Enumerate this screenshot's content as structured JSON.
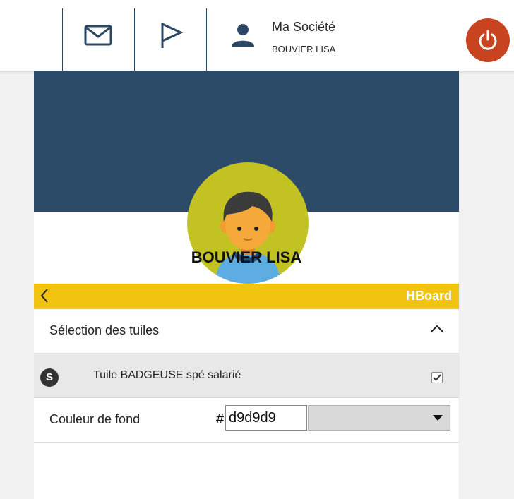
{
  "topbar": {
    "company_name": "Ma Société",
    "user_name": "BOUVIER LISA",
    "icons": [
      "mail-icon",
      "flag-icon",
      "user-icon",
      "power-icon"
    ],
    "power_color": "#c8431f"
  },
  "profile": {
    "name": "BOUVIER LISA",
    "banner_color": "#2c4b69",
    "avatar_bg": "#c2c323"
  },
  "hboard": {
    "title": "HBoard",
    "bar_color": "#f1c40f"
  },
  "section": {
    "title": "Sélection des tuiles"
  },
  "tile": {
    "badge": "S",
    "label": "Tuile BADGEUSE spé salarié",
    "checked": true
  },
  "background_color": {
    "label": "Couleur de fond",
    "hash": "#",
    "value": "d9d9d9",
    "swatch": "#d9d9d9"
  }
}
